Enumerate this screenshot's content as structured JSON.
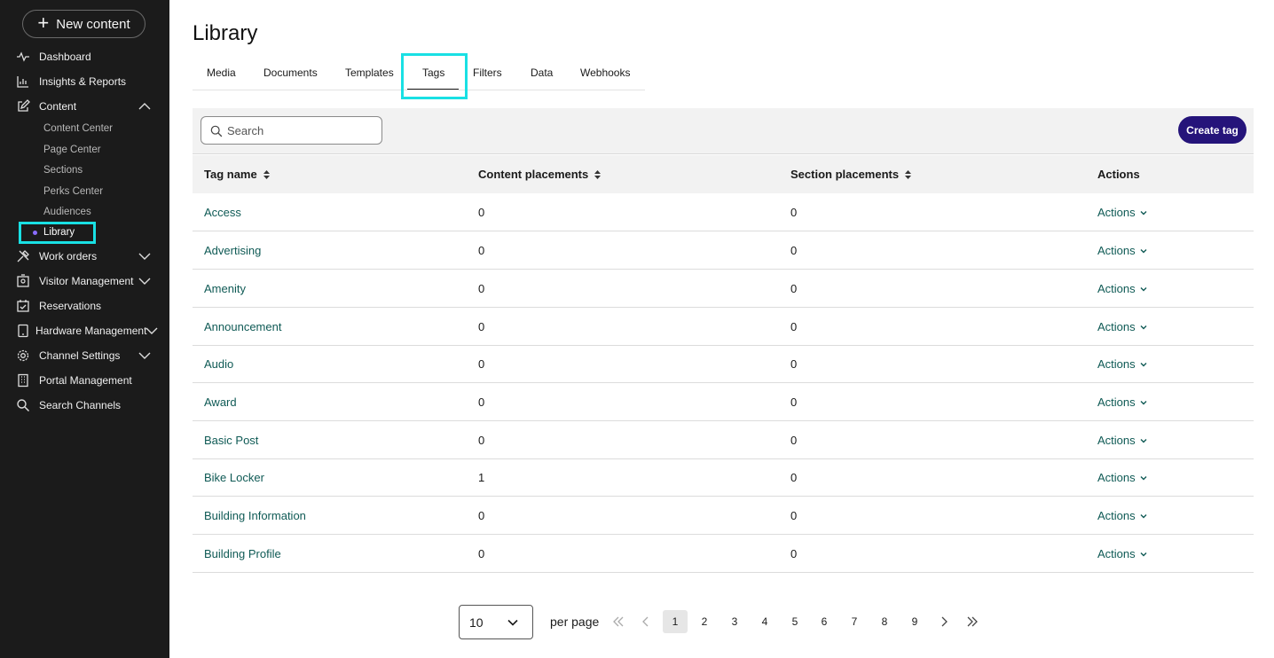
{
  "sidebar": {
    "new_content_label": "New content",
    "items": [
      {
        "label": "Dashboard",
        "icon": "activity-icon"
      },
      {
        "label": "Insights & Reports",
        "icon": "bar-chart-icon"
      },
      {
        "label": "Content",
        "icon": "edit-icon",
        "expanded": true
      },
      {
        "label": "Work orders",
        "icon": "tools-icon"
      },
      {
        "label": "Visitor Management",
        "icon": "badge-icon"
      },
      {
        "label": "Reservations",
        "icon": "calendar-icon"
      },
      {
        "label": "Hardware Management",
        "icon": "tablet-icon"
      },
      {
        "label": "Channel Settings",
        "icon": "gear-icon"
      },
      {
        "label": "Portal Management",
        "icon": "building-icon"
      },
      {
        "label": "Search Channels",
        "icon": "search-icon"
      }
    ],
    "content_sub_items": [
      "Content Center",
      "Page Center",
      "Sections",
      "Perks Center",
      "Audiences",
      "Library"
    ]
  },
  "page": {
    "title": "Library",
    "tabs": [
      "Media",
      "Documents",
      "Templates",
      "Tags",
      "Filters",
      "Data",
      "Webhooks"
    ],
    "active_tab": "Tags"
  },
  "toolbar": {
    "search_placeholder": "Search",
    "create_label": "Create tag"
  },
  "table": {
    "columns": [
      "Tag name",
      "Content placements",
      "Section placements",
      "Actions"
    ],
    "rows": [
      {
        "name": "Access",
        "content": "0",
        "section": "0",
        "action": "Actions"
      },
      {
        "name": "Advertising",
        "content": "0",
        "section": "0",
        "action": "Actions"
      },
      {
        "name": "Amenity",
        "content": "0",
        "section": "0",
        "action": "Actions"
      },
      {
        "name": "Announcement",
        "content": "0",
        "section": "0",
        "action": "Actions"
      },
      {
        "name": "Audio",
        "content": "0",
        "section": "0",
        "action": "Actions"
      },
      {
        "name": "Award",
        "content": "0",
        "section": "0",
        "action": "Actions"
      },
      {
        "name": "Basic Post",
        "content": "0",
        "section": "0",
        "action": "Actions"
      },
      {
        "name": "Bike Locker",
        "content": "1",
        "section": "0",
        "action": "Actions"
      },
      {
        "name": "Building Information",
        "content": "0",
        "section": "0",
        "action": "Actions"
      },
      {
        "name": "Building Profile",
        "content": "0",
        "section": "0",
        "action": "Actions"
      }
    ]
  },
  "pagination": {
    "per_page_value": "10",
    "per_page_label": "per page",
    "pages": [
      "1",
      "2",
      "3",
      "4",
      "5",
      "6",
      "7",
      "8",
      "9"
    ],
    "current_page": "1"
  },
  "colors": {
    "sidebar_bg": "#1b1b1b",
    "highlight": "#19e0e4",
    "primary_button": "#25147a",
    "link": "#0f5a55"
  }
}
